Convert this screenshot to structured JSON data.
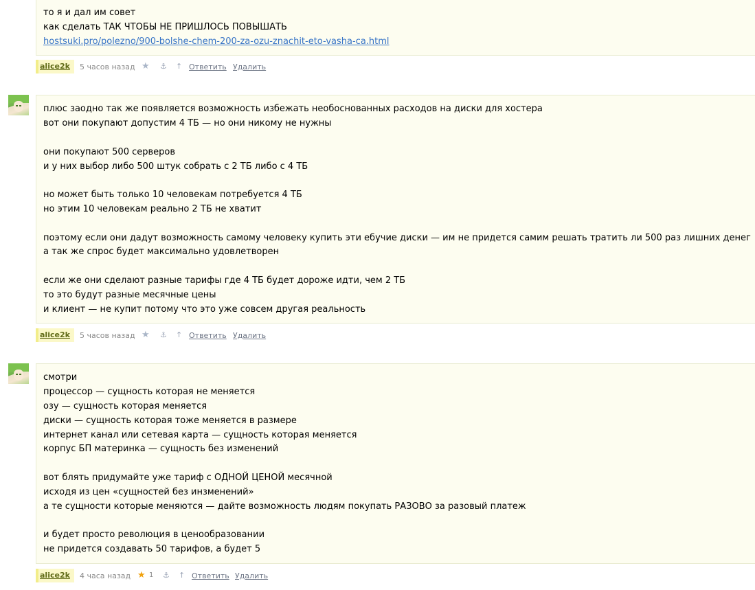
{
  "comments": [
    {
      "lines": [
        "то я и дал им совет",
        "как сделать ТАК ЧТОБЫ НЕ ПРИШЛОСЬ ПОВЫШАТЬ"
      ],
      "link": "hostsuki.pro/polezno/900-bolshe-chem-200-za-ozu-znachit-eto-vasha-ca.html",
      "meta": {
        "user": "alice2k",
        "time": "5 часов назад",
        "reply": "Ответить",
        "delete": "Удалить"
      }
    },
    {
      "lines": [
        "плюс заодно так же появляется возможность избежать необоснованных расходов на диски для хостера",
        "вот они покупают допустим 4 ТБ — но они никому не нужны",
        "",
        "они покупают 500 серверов",
        "и у них выбор либо 500 штук собрать с 2 ТБ либо с 4 ТБ",
        "",
        "но может быть только 10 человекам потребуется 4 ТБ",
        "но этим 10 человекам реально 2 ТБ не хватит",
        "",
        "поэтому если они дадут возможность самому человеку купить эти ебучие диски — им не придется самим решать тратить ли 500 раз лишних денег",
        "а так же спрос будет максимально удовлетворен",
        "",
        "если же они сделают разные тарифы где 4 ТБ будет дороже идти, чем 2 ТБ",
        "то это будут разные месячные цены",
        "и клиент — не купит потому что это уже совсем другая реальность"
      ],
      "meta": {
        "user": "alice2k",
        "time": "5 часов назад",
        "reply": "Ответить",
        "delete": "Удалить"
      }
    },
    {
      "lines": [
        "смотри",
        "процессор — сущность которая не меняется",
        "озу — сущность которая меняется",
        "диски — сущность которая тоже меняется в размере",
        "интернет канал или сетевая карта — сущность которая меняется",
        "корпус БП материнка — сущность без изменений",
        "",
        "вот блять придумайте уже тариф с ОДНОЙ ЦЕНОЙ месячной",
        "исходя из цен «сущностей без инзменений»",
        "а те сущности которые меняются — дайте возможность людям покупать РАЗОВО за разовый платеж",
        "",
        "и будет просто революция в ценообразовании",
        "не придется создавать 50 тарифов, а будет 5"
      ],
      "meta": {
        "user": "alice2k",
        "time": "4 часа назад",
        "star_count": "1",
        "reply": "Ответить",
        "delete": "Удалить"
      }
    }
  ],
  "icons": {
    "star": "star-icon",
    "anchor": "anchor-icon",
    "up": "arrow-up-icon"
  },
  "colors": {
    "box_bg": "#fdfdf0",
    "link": "#3673c6",
    "user_bg": "#fbf8c8",
    "star_active": "#f0a10e"
  }
}
